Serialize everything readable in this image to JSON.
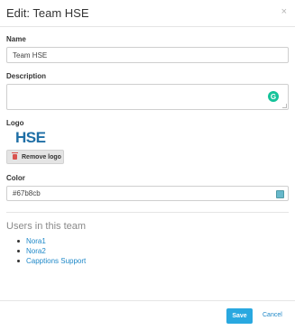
{
  "modal": {
    "title": "Edit: Team HSE",
    "close_icon": "×"
  },
  "form": {
    "name_label": "Name",
    "name_value": "Team HSE",
    "description_label": "Description",
    "description_value": "",
    "grammarly_icon": "grammarly-icon",
    "logo_label": "Logo",
    "logo_text": "HSE",
    "remove_logo_label": "Remove logo",
    "color_label": "Color",
    "color_value": "#67b8cb"
  },
  "users": {
    "section_title": "Users in this team",
    "items": [
      "Nora1",
      "Nora2",
      "Capptions Support"
    ]
  },
  "footer": {
    "save_label": "Save",
    "cancel_label": "Cancel"
  },
  "colors": {
    "accent": "#29a8e0",
    "link": "#1e88c8",
    "team_color": "#67b8cb",
    "logo": "#1f6fa6"
  }
}
